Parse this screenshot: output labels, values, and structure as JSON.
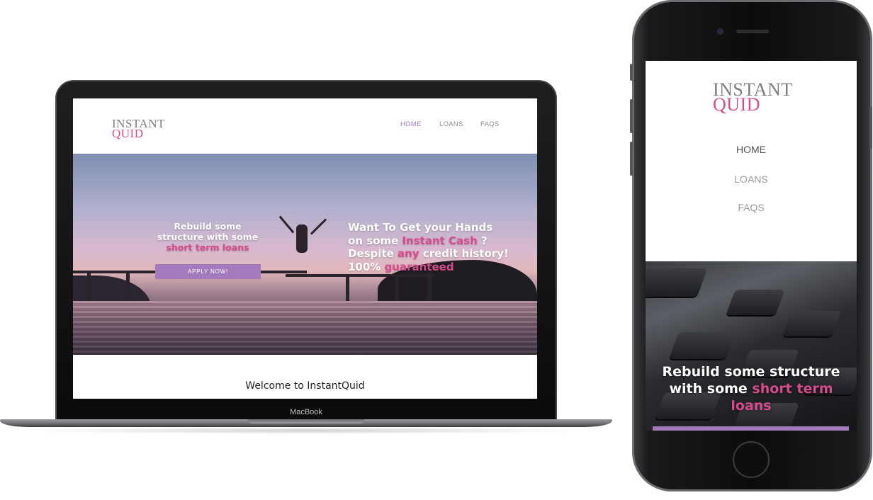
{
  "desktop": {
    "device_label": "MacBook",
    "logo": {
      "line1": "INSTANT",
      "line2": "QUID"
    },
    "nav": [
      {
        "label": "HOME",
        "active": true
      },
      {
        "label": "LOANS",
        "active": false
      },
      {
        "label": "FAQS",
        "active": false
      }
    ],
    "hero": {
      "left_line1": "Rebuild some",
      "left_line2": "structure with some",
      "left_highlight": "short term loans",
      "apply_label": "APPLY NOW!",
      "right_line1": "Want To Get your Hands",
      "right_line2_pre": "on some ",
      "right_line2_highlight": "Instant Cash",
      "right_line2_post": " ?",
      "right_line3_pre": "Despite ",
      "right_line3_highlight": "any",
      "right_line3_post": " credit history!",
      "right_line4_pre": "100% ",
      "right_line4_highlight": "guaranteed"
    },
    "welcome": "Welcome to InstantQuid"
  },
  "mobile": {
    "logo": {
      "line1": "INSTANT",
      "line2": "QUID"
    },
    "nav": [
      {
        "label": "HOME",
        "active": true
      },
      {
        "label": "LOANS",
        "active": false
      },
      {
        "label": "FAQS",
        "active": false
      }
    ],
    "hero": {
      "line1": "Rebuild some structure",
      "line2_pre": "with some ",
      "line2_highlight": "short term",
      "line3_highlight": "loans"
    }
  },
  "colors": {
    "accent_pink": "#d54c8d",
    "accent_purple": "#a37bbd",
    "logo_gray": "#7d7d7d"
  },
  "icons": [
    "camera-icon",
    "speaker-icon",
    "home-button-icon"
  ]
}
